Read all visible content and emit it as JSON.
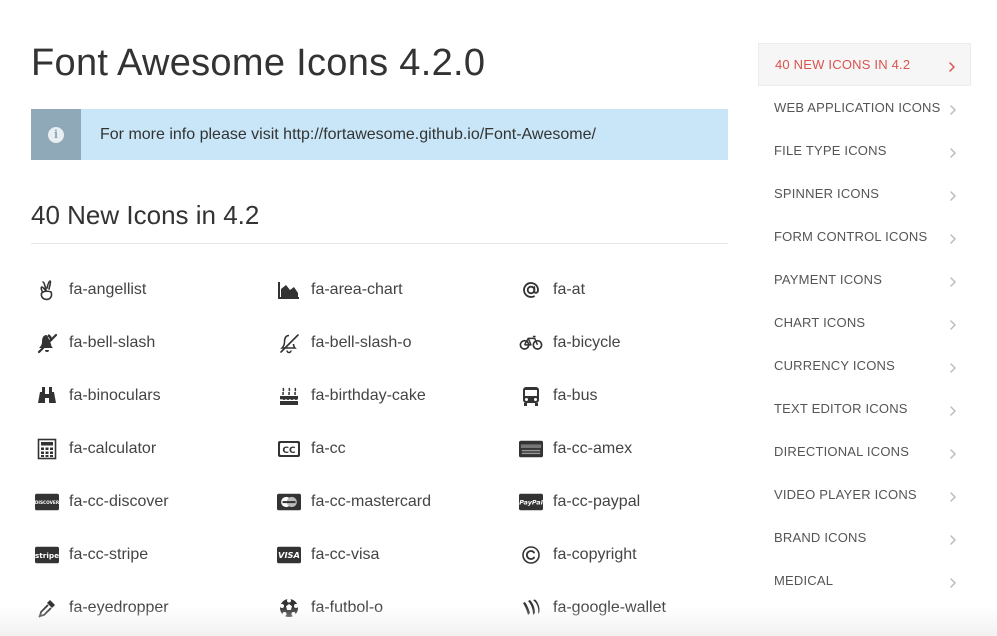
{
  "header": {
    "title": "Font Awesome Icons 4.2.0"
  },
  "info": {
    "icon": "info-circle-icon",
    "text": "For more info please visit http://fortawesome.github.io/Font-Awesome/"
  },
  "section": {
    "title": "40 New Icons in 4.2"
  },
  "icons": [
    {
      "name": "fa-angellist",
      "icon": "angellist-icon"
    },
    {
      "name": "fa-area-chart",
      "icon": "area-chart-icon"
    },
    {
      "name": "fa-at",
      "icon": "at-icon"
    },
    {
      "name": "fa-bell-slash",
      "icon": "bell-slash-icon"
    },
    {
      "name": "fa-bell-slash-o",
      "icon": "bell-slash-o-icon"
    },
    {
      "name": "fa-bicycle",
      "icon": "bicycle-icon"
    },
    {
      "name": "fa-binoculars",
      "icon": "binoculars-icon"
    },
    {
      "name": "fa-birthday-cake",
      "icon": "birthday-cake-icon"
    },
    {
      "name": "fa-bus",
      "icon": "bus-icon"
    },
    {
      "name": "fa-calculator",
      "icon": "calculator-icon"
    },
    {
      "name": "fa-cc",
      "icon": "cc-icon"
    },
    {
      "name": "fa-cc-amex",
      "icon": "cc-amex-icon"
    },
    {
      "name": "fa-cc-discover",
      "icon": "cc-discover-icon"
    },
    {
      "name": "fa-cc-mastercard",
      "icon": "cc-mastercard-icon"
    },
    {
      "name": "fa-cc-paypal",
      "icon": "cc-paypal-icon"
    },
    {
      "name": "fa-cc-stripe",
      "icon": "cc-stripe-icon"
    },
    {
      "name": "fa-cc-visa",
      "icon": "cc-visa-icon"
    },
    {
      "name": "fa-copyright",
      "icon": "copyright-icon"
    },
    {
      "name": "fa-eyedropper",
      "icon": "eyedropper-icon"
    },
    {
      "name": "fa-futbol-o",
      "icon": "futbol-o-icon"
    },
    {
      "name": "fa-google-wallet",
      "icon": "google-wallet-icon"
    }
  ],
  "sidebar": {
    "items": [
      {
        "label": "40 NEW ICONS IN 4.2",
        "active": true
      },
      {
        "label": "WEB APPLICATION ICONS",
        "active": false
      },
      {
        "label": "FILE TYPE ICONS",
        "active": false
      },
      {
        "label": "SPINNER ICONS",
        "active": false
      },
      {
        "label": "FORM CONTROL ICONS",
        "active": false
      },
      {
        "label": "PAYMENT ICONS",
        "active": false
      },
      {
        "label": "CHART ICONS",
        "active": false
      },
      {
        "label": "CURRENCY ICONS",
        "active": false
      },
      {
        "label": "TEXT EDITOR ICONS",
        "active": false
      },
      {
        "label": "DIRECTIONAL ICONS",
        "active": false
      },
      {
        "label": "VIDEO PLAYER ICONS",
        "active": false
      },
      {
        "label": "BRAND ICONS",
        "active": false
      },
      {
        "label": "MEDICAL",
        "active": false
      }
    ]
  },
  "colors": {
    "info_background": "#c9e6f8",
    "info_icon_background": "#8fa9b8",
    "active_text": "#d9534f",
    "text": "#333333"
  }
}
